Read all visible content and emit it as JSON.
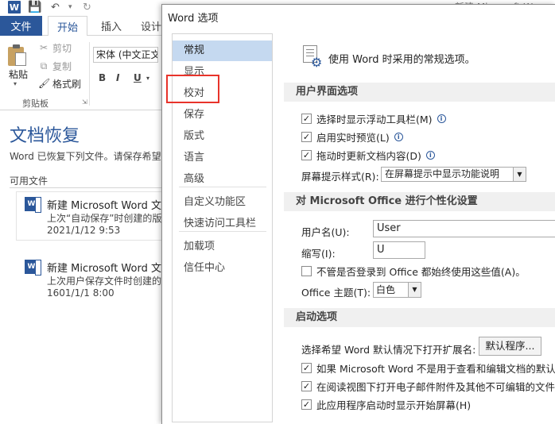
{
  "app": {
    "title_fragment": "新建 Microsoft Word 文档",
    "quick_access": {
      "word_logo": "W",
      "save_icon": "save-icon",
      "undo_icon": "undo-icon",
      "redo_icon": "redo-icon"
    }
  },
  "ribbon": {
    "tabs": [
      {
        "label": "文件"
      },
      {
        "label": "开始"
      },
      {
        "label": "插入"
      },
      {
        "label": "设计"
      }
    ],
    "clipboard": {
      "paste": "粘贴",
      "cut": "剪切",
      "copy": "复制",
      "format_painter": "格式刷",
      "group_label": "剪贴板"
    },
    "font": {
      "font_name": "宋体 (中文正文",
      "bold": "B",
      "italic": "I",
      "underline": "U"
    }
  },
  "recovery": {
    "title": "文档恢复",
    "description": "Word 已恢复下列文件。请保存希望",
    "available_label": "可用文件",
    "files": [
      {
        "name": "新建 Microsoft Word 文档",
        "subtitle": "上次“自动保存”时创建的版本",
        "date": "2021/1/12 9:53"
      },
      {
        "name": "新建 Microsoft Word 文档",
        "subtitle": "上次用户保存文件时创建的版本",
        "date": "1601/1/1 8:00"
      }
    ]
  },
  "dialog": {
    "title": "Word 选项",
    "nav": [
      {
        "label": "常规",
        "selected": true
      },
      {
        "label": "显示"
      },
      {
        "label": "校对"
      },
      {
        "label": "保存"
      },
      {
        "label": "版式"
      },
      {
        "label": "语言"
      },
      {
        "label": "高级"
      },
      {
        "label": "自定义功能区"
      },
      {
        "label": "快速访问工具栏"
      },
      {
        "label": "加载项"
      },
      {
        "label": "信任中心"
      }
    ],
    "heading": "使用 Word 时采用的常规选项。",
    "ui_section": {
      "header": "用户界面选项",
      "options": [
        {
          "label": "选择时显示浮动工具栏(M)",
          "checked": true
        },
        {
          "label": "启用实时预览(L)",
          "checked": true
        },
        {
          "label": "拖动时更新文档内容(D)",
          "checked": true
        }
      ],
      "screentip_label": "屏幕提示样式(R):",
      "screentip_value": "在屏幕提示中显示功能说明"
    },
    "personal_section": {
      "header": "对 Microsoft Office 进行个性化设置",
      "username_label": "用户名(U):",
      "username_value": "User",
      "initials_label": "缩写(I):",
      "initials_value": "U",
      "always_use_label": "不管是否登录到 Office 都始终使用这些值(A)。",
      "always_use_checked": false,
      "theme_label": "Office 主题(T):",
      "theme_value": "白色"
    },
    "startup_section": {
      "header": "启动选项",
      "extensions_label": "选择希望 Word 默认情况下打开扩展名:",
      "default_programs_button": "默认程序...",
      "options": [
        {
          "label": "如果 Microsoft Word 不是用于查看和编辑文档的默认程",
          "checked": true
        },
        {
          "label": "在阅读视图下打开电子邮件附件及其他不可编辑的文件(O",
          "checked": true
        },
        {
          "label": "此应用程序启动时显示开始屏幕(H)",
          "checked": true
        }
      ]
    }
  },
  "colors": {
    "word_blue": "#2b579a",
    "nav_selected": "#c5d9f0",
    "highlight_red": "#e8332a",
    "section_bg": "#f0f0f0"
  }
}
